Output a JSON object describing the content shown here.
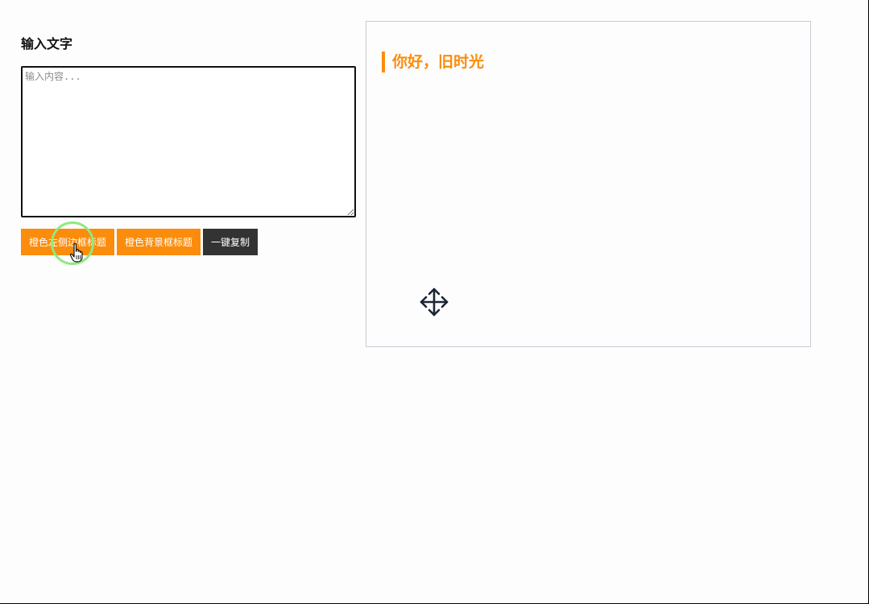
{
  "editor": {
    "title": "输入文字",
    "placeholder": "输入内容...",
    "value": ""
  },
  "buttons": {
    "orange_left_border": "橙色左侧边框标题",
    "orange_background": "橙色背景框标题",
    "copy_all": "一键复制"
  },
  "preview": {
    "heading": "你好，旧时光"
  },
  "colors": {
    "accent": "#fb8c0c",
    "dark_button": "#333333",
    "click_ring": "#8fea7e"
  },
  "icons": {
    "pointer": "hand-pointer-icon",
    "move": "move-cursor-icon"
  }
}
